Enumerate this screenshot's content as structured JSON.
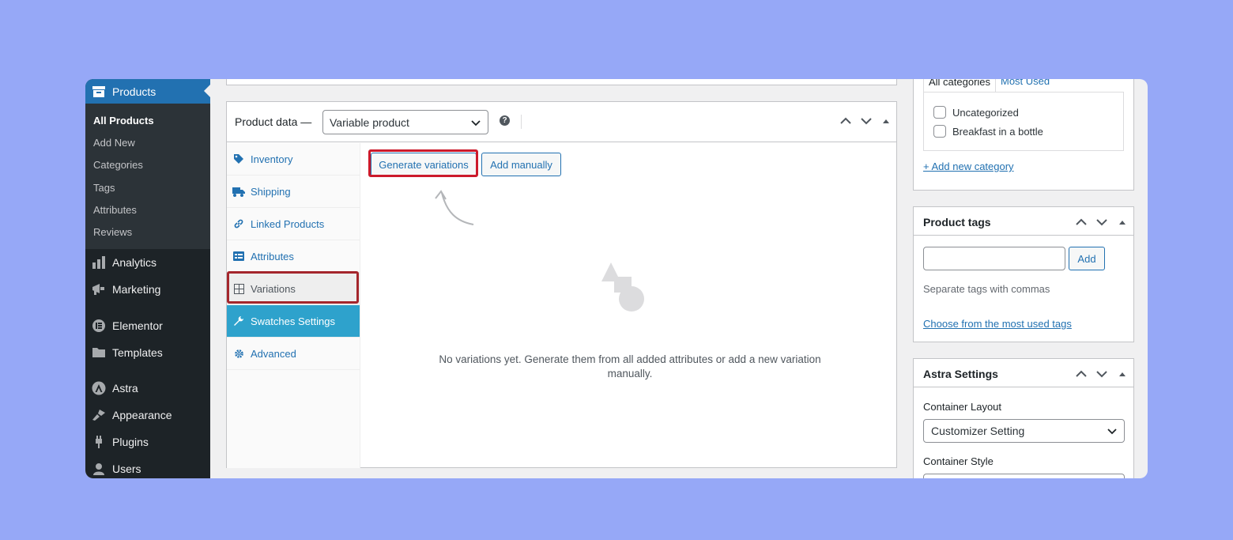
{
  "admin_menu": {
    "active_section": "Products",
    "submenu": [
      "All Products",
      "Add New",
      "Categories",
      "Tags",
      "Attributes",
      "Reviews"
    ],
    "current_submenu": "All Products",
    "items": [
      "Analytics",
      "Marketing",
      "Elementor",
      "Templates",
      "Astra",
      "Appearance",
      "Plugins",
      "Users"
    ]
  },
  "product_data": {
    "title": "Product data —",
    "type_select": "Variable product",
    "help_icon": "?",
    "tabs": [
      "Inventory",
      "Shipping",
      "Linked Products",
      "Attributes",
      "Variations",
      "Swatches Settings",
      "Advanced"
    ],
    "active_tab": "Swatches Settings",
    "highlighted_tab": "Variations",
    "buttons": {
      "generate": "Generate variations",
      "add_manually": "Add manually"
    },
    "empty_message": "No variations yet. Generate them from all added attributes or add a new variation manually."
  },
  "categories": {
    "tabs": [
      "All categories",
      "Most Used"
    ],
    "items": [
      "Uncategorized",
      "Breakfast in a bottle"
    ],
    "add_link": "+ Add new category"
  },
  "product_tags": {
    "title": "Product tags",
    "add_button": "Add",
    "hint": "Separate tags with commas",
    "most_used_link": "Choose from the most used tags"
  },
  "astra_settings": {
    "title": "Astra Settings",
    "container_layout_label": "Container Layout",
    "container_layout_value": "Customizer Setting",
    "container_style_label": "Container Style"
  },
  "colors": {
    "accent": "#2271b1",
    "sidebar": "#1d2327",
    "highlight": "#cc1a2b",
    "background": "#96a8f7"
  }
}
